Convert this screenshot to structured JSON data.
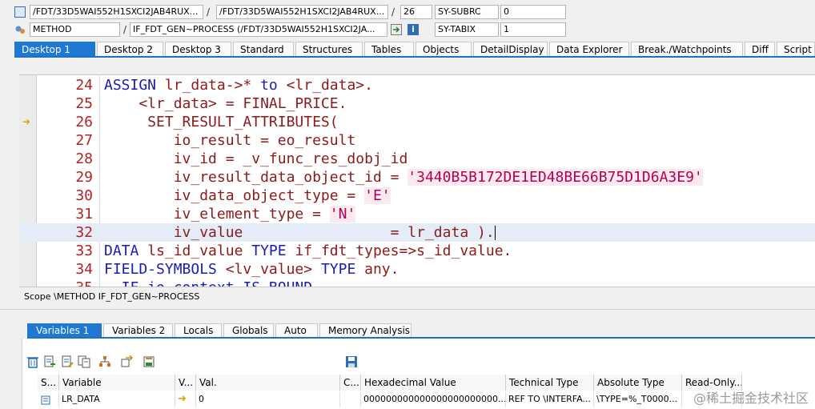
{
  "header": {
    "row1": {
      "program": "/FDT/33D5WAI552H1SXCI2JAB4RUX...",
      "include": "/FDT/33D5WAI552H1SXCI2JAB4RUX...",
      "line": "26",
      "sysfield": "SY-SUBRC",
      "sysvalue": "0"
    },
    "row2": {
      "event_type": "METHOD",
      "event": "IF_FDT_GEN~PROCESS (/FDT/33D5WAI552H1SXCI2JA...",
      "sysfield": "SY-TABIX",
      "sysvalue": "1"
    },
    "separator": "/"
  },
  "tabs": [
    "Desktop 1",
    "Desktop 2",
    "Desktop 3",
    "Standard",
    "Structures",
    "Tables",
    "Objects",
    "DetailDisplay",
    "Data Explorer",
    "Break./Watchpoints",
    "Diff",
    "Script"
  ],
  "code": {
    "numbers": [
      "24",
      "25",
      "26",
      "27",
      "28",
      "29",
      "30",
      "31",
      "32",
      "33",
      "34",
      "35"
    ],
    "l24": {
      "kw1": "ASSIGN",
      "t1": " lr_data->* ",
      "kw2": "to",
      "t2": " <lr_data>."
    },
    "l25": {
      "t": "    <lr_data> = FINAL_PRICE."
    },
    "l26": {
      "t": "     SET_RESULT_ATTRIBUTES("
    },
    "l27": {
      "t": "        io_result = eo_result"
    },
    "l28": {
      "t": "        iv_id = _v_func_res_dobj_id"
    },
    "l29": {
      "t": "        iv_result_data_object_id = ",
      "s": "'3440B5B172DE1ED48BE66B75D1D6A3E9'"
    },
    "l30": {
      "t": "        iv_data_object_type = ",
      "s": "'E'"
    },
    "l31": {
      "t": "        iv_element_type = ",
      "s": "'N'"
    },
    "l32": {
      "t": "        iv_value                 = lr_data )."
    },
    "l33": {
      "kw1": "DATA",
      "t1": " ls_id_value ",
      "kw2": "TYPE",
      "t2": " if_fdt_types=>s_id_value."
    },
    "l34": {
      "kw1": "FIELD-SYMBOLS",
      "t1": " <lv_value> ",
      "kw2": "TYPE",
      "t2": " any."
    },
    "l35": {
      "t": "  IF io_context IS BOUND"
    }
  },
  "scope": "Scope \\METHOD IF_FDT_GEN~PROCESS",
  "var_tabs": [
    "Variables 1",
    "Variables 2",
    "Locals",
    "Globals",
    "Auto",
    "Memory Analysis"
  ],
  "table": {
    "headers": [
      "S...",
      "Variable",
      "V...",
      "Val.",
      "C...",
      "Hexadecimal Value",
      "Technical Type",
      "Absolute Type",
      "Read-Only..."
    ],
    "row": {
      "variable": "LR_DATA",
      "value": "0",
      "hex": "000000000000000000000000...",
      "technical_type": "REF TO \\INTERFA...",
      "absolute_type": "\\TYPE=%_T0000..."
    }
  },
  "watermark": "@稀土掘金技术社区"
}
